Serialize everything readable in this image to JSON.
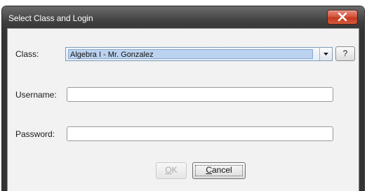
{
  "dialog": {
    "title": "Select Class and Login",
    "close_icon": "close-x-icon"
  },
  "form": {
    "class_label": "Class:",
    "class_value": "Algebra I - Mr. Gonzalez",
    "help_label": "?",
    "username_label": "Username:",
    "username_value": "",
    "password_label": "Password:",
    "password_value": ""
  },
  "buttons": {
    "ok_mnemonic": "O",
    "ok_rest": "K",
    "ok_enabled": false,
    "cancel_mnemonic": "C",
    "cancel_rest": "ancel"
  },
  "colors": {
    "close_button": "#d4553d",
    "selection": "#bcd3ef"
  }
}
